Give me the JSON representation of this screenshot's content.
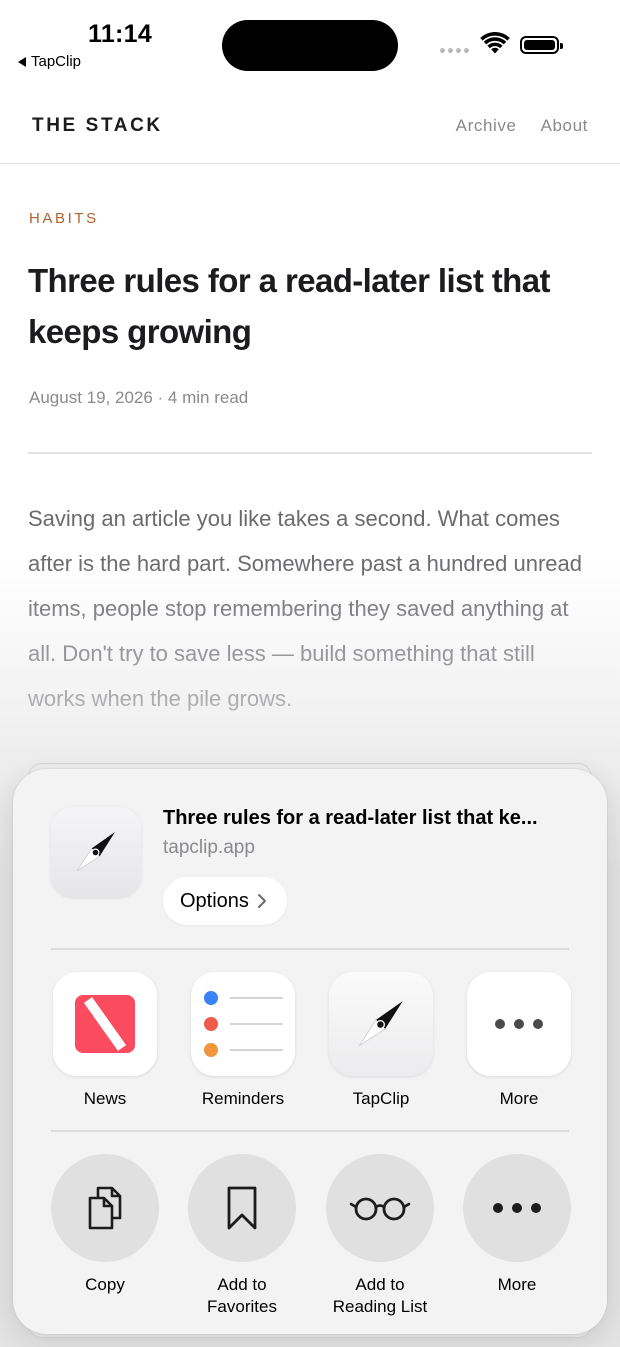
{
  "status_bar": {
    "time": "11:14",
    "back_app": "TapClip"
  },
  "site": {
    "brand": "THE STACK",
    "nav": [
      "Archive",
      "About"
    ]
  },
  "article": {
    "category": "HABITS",
    "title": "Three rules for a read-later list that keeps growing",
    "meta": "August 19, 2026 · 4 min read",
    "body": "Saving an article you like takes a second. What comes after is the hard part. Somewhere past a hundred unread items, people stop remembering they saved anything at all. Don't try to save less — build something that still works when the pile grows."
  },
  "share_sheet": {
    "preview": {
      "title": "Three rules for a read-later list that ke...",
      "url": "tapclip.app",
      "options_label": "Options"
    },
    "apps": [
      {
        "label": "News",
        "icon": "news-icon"
      },
      {
        "label": "Reminders",
        "icon": "reminders-icon"
      },
      {
        "label": "TapClip",
        "icon": "compass-icon"
      },
      {
        "label": "More",
        "icon": "more-dots-icon"
      }
    ],
    "actions": [
      {
        "label": "Copy",
        "icon": "copy-icon"
      },
      {
        "label": "Add to\nFavorites",
        "icon": "bookmark-icon"
      },
      {
        "label": "Add to\nReading List",
        "icon": "glasses-icon"
      },
      {
        "label": "More",
        "icon": "more-dots-icon"
      }
    ]
  },
  "colors": {
    "accent_category": "#b0622e",
    "news_red": "#fa4b5f",
    "reminder_blue": "#3b82f6",
    "reminder_red": "#ef5a4b",
    "reminder_orange": "#f0973a"
  }
}
